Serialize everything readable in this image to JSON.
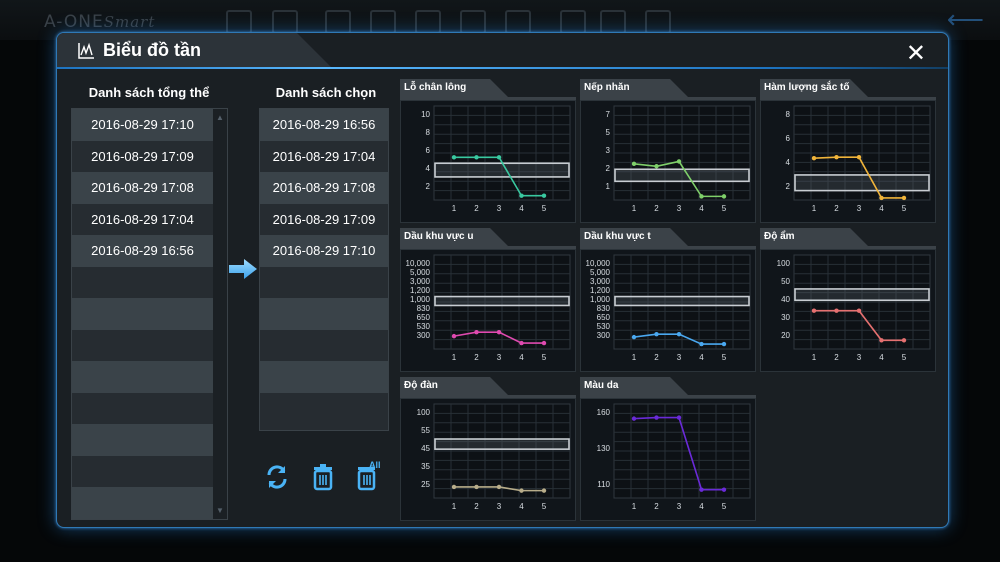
{
  "background": {
    "brand": "A-ONE",
    "brand_script": "Smart",
    "icons": [
      "camera-icon",
      "clipboard-icon",
      "portrait-icon",
      "3d-cube-icon",
      "face-icon",
      "chart-icon",
      "document-icon",
      "printer-icon",
      "save-icon",
      "export-icon"
    ]
  },
  "window": {
    "title": "Biểu đồ tần",
    "close_icon": "close-icon"
  },
  "overall_list": {
    "header": "Danh sách tổng thể",
    "items": [
      "2016-08-29 17:10",
      "2016-08-29 17:09",
      "2016-08-29 17:08",
      "2016-08-29 17:04",
      "2016-08-29 16:56"
    ]
  },
  "selected_list": {
    "header": "Danh sách chọn",
    "items": [
      "2016-08-29 16:56",
      "2016-08-29 17:04",
      "2016-08-29 17:08",
      "2016-08-29 17:09",
      "2016-08-29 17:10"
    ]
  },
  "tools": {
    "refresh": "refresh-icon",
    "delete": "trash-icon",
    "delete_all": "trash-all-icon",
    "delete_all_badge": "All"
  },
  "colors": {
    "accent": "#2f8fe0",
    "series": [
      "#39c9a0",
      "#7fd06a",
      "#f0b43a",
      "#e04ab0",
      "#4aa8f0",
      "#e57070",
      "#b8ad8a",
      "#6a2ad8"
    ]
  },
  "chart_data": [
    {
      "type": "line",
      "title": "Lỗ chân lông",
      "x": [
        1,
        2,
        3,
        4,
        5
      ],
      "values": [
        5,
        5,
        5,
        0.5,
        0.5
      ],
      "yticks": [
        "2",
        "4",
        "6",
        "8",
        "10"
      ],
      "ylim": [
        0,
        11
      ],
      "band": [
        2.7,
        4.3
      ],
      "color": "#39c9a0"
    },
    {
      "type": "line",
      "title": "Nếp nhăn",
      "x": [
        1,
        2,
        3,
        4,
        5
      ],
      "values": [
        3,
        2.8,
        3.2,
        0.3,
        0.3
      ],
      "yticks": [
        "1",
        "2",
        "3",
        "5",
        "7"
      ],
      "ylim": [
        0,
        7.8
      ],
      "band": [
        1.55,
        2.55
      ],
      "color": "#7fd06a"
    },
    {
      "type": "line",
      "title": "Hàm lượng sắc tố",
      "x": [
        1,
        2,
        3,
        4,
        5
      ],
      "values": [
        4,
        4.1,
        4.1,
        0.2,
        0.2
      ],
      "yticks": [
        "2",
        "4",
        "6",
        "8"
      ],
      "ylim": [
        0,
        9
      ],
      "band": [
        0.9,
        2.4
      ],
      "color": "#f0b43a"
    },
    {
      "type": "line",
      "title": "Dầu khu vực u",
      "x": [
        1,
        2,
        3,
        4,
        5
      ],
      "values": [
        0.3,
        0.7,
        0.7,
        -0.4,
        -0.4
      ],
      "yticks": [
        "300",
        "530",
        "650",
        "830",
        "1,000",
        "1,200",
        "3,000",
        "5,000",
        "10,000"
      ],
      "ylim": [
        -1,
        8.5
      ],
      "band": [
        3.4,
        4.3
      ],
      "color": "#e04ab0"
    },
    {
      "type": "line",
      "title": "Dầu khu vực t",
      "x": [
        1,
        2,
        3,
        4,
        5
      ],
      "values": [
        0.2,
        0.5,
        0.5,
        -0.5,
        -0.5
      ],
      "yticks": [
        "300",
        "530",
        "650",
        "830",
        "1,000",
        "1,200",
        "3,000",
        "5,000",
        "10,000"
      ],
      "ylim": [
        -1,
        8.5
      ],
      "band": [
        3.4,
        4.3
      ],
      "color": "#4aa8f0"
    },
    {
      "type": "line",
      "title": "Độ ẩm",
      "x": [
        1,
        2,
        3,
        4,
        5
      ],
      "values": [
        1.6,
        1.6,
        1.6,
        -0.1,
        -0.1
      ],
      "yticks": [
        "20",
        "30",
        "40",
        "50",
        "100"
      ],
      "ylim": [
        -0.6,
        4.8
      ],
      "band": [
        2.2,
        2.85
      ],
      "color": "#e57070"
    },
    {
      "type": "line",
      "title": "Độ đàn",
      "x": [
        1,
        2,
        3,
        4,
        5
      ],
      "values": [
        0.1,
        0.1,
        0.1,
        -0.1,
        -0.1
      ],
      "yticks": [
        "25",
        "35",
        "45",
        "55",
        "100"
      ],
      "ylim": [
        -0.5,
        4.6
      ],
      "band": [
        2.15,
        2.7
      ],
      "color": "#b8ad8a"
    },
    {
      "type": "line",
      "title": "Màu da",
      "x": [
        1,
        2,
        3,
        4,
        5
      ],
      "values": [
        3.2,
        3.25,
        3.25,
        -0.2,
        -0.2
      ],
      "yticks": [
        "110",
        "130",
        "160"
      ],
      "ylim": [
        -0.6,
        3.9
      ],
      "band": null,
      "color": "#6a2ad8"
    }
  ]
}
